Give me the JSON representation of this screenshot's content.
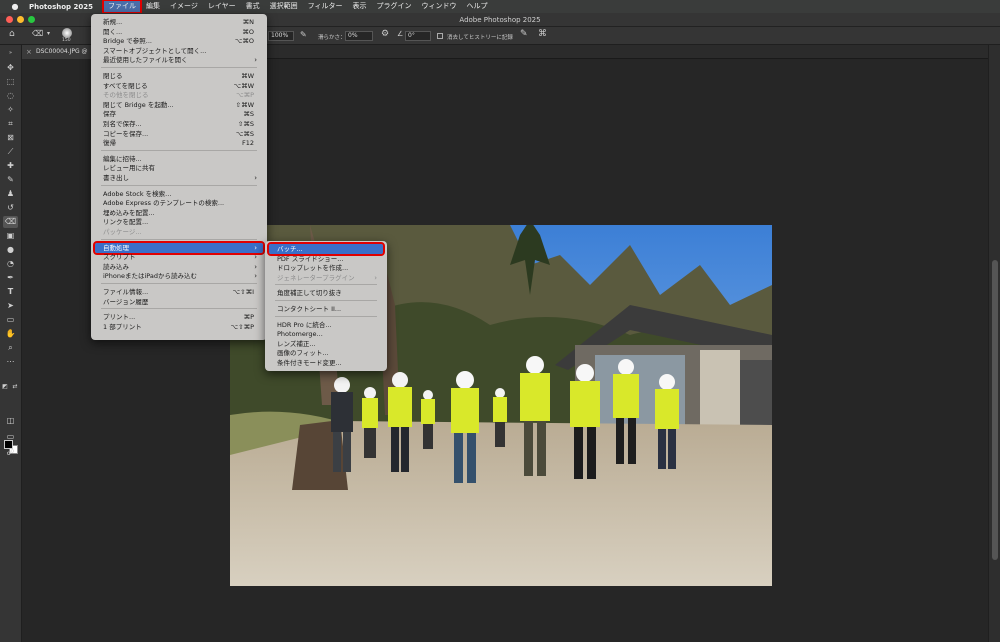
{
  "menubar": {
    "app_name": "Photoshop 2025",
    "items": [
      "ファイル",
      "編集",
      "イメージ",
      "レイヤー",
      "書式",
      "選択範囲",
      "フィルター",
      "表示",
      "プラグイン",
      "ウィンドウ",
      "ヘルプ"
    ]
  },
  "window": {
    "title": "Adobe Photoshop 2025"
  },
  "options_bar": {
    "brush_size": "150",
    "opacity_value": "100%",
    "smoothing_label": "滑らかさ：",
    "smoothing_value": "0%",
    "angle_value": "0°",
    "history_label": "消去してヒストリーに記録"
  },
  "document_tab": {
    "name": "DSC00004.JPG @"
  },
  "file_menu": {
    "groups": [
      [
        {
          "label": "新規...",
          "shortcut": "⌘N"
        },
        {
          "label": "開く...",
          "shortcut": "⌘O"
        },
        {
          "label": "Bridge で参照...",
          "shortcut": "⌥⌘O"
        },
        {
          "label": "スマートオブジェクトとして開く..."
        },
        {
          "label": "最近使用したファイルを開く",
          "submenu": true
        }
      ],
      [
        {
          "label": "閉じる",
          "shortcut": "⌘W"
        },
        {
          "label": "すべてを閉じる",
          "shortcut": "⌥⌘W"
        },
        {
          "label": "その他を閉じる",
          "shortcut": "⌥⌘P",
          "disabled": true
        },
        {
          "label": "閉じて Bridge を起動...",
          "shortcut": "⇧⌘W"
        },
        {
          "label": "保存",
          "shortcut": "⌘S"
        },
        {
          "label": "別名で保存...",
          "shortcut": "⇧⌘S"
        },
        {
          "label": "コピーを保存...",
          "shortcut": "⌥⌘S"
        },
        {
          "label": "復帰",
          "shortcut": "F12"
        }
      ],
      [
        {
          "label": "編集に招待..."
        },
        {
          "label": "レビュー用に共有"
        },
        {
          "label": "書き出し",
          "submenu": true
        }
      ],
      [
        {
          "label": "Adobe Stock を検索..."
        },
        {
          "label": "Adobe Express のテンプレートの検索..."
        },
        {
          "label": "埋め込みを配置..."
        },
        {
          "label": "リンクを配置..."
        },
        {
          "label": "パッケージ...",
          "disabled": true
        }
      ],
      [
        {
          "label": "自動処理",
          "submenu": true,
          "highlighted": true
        },
        {
          "label": "スクリプト",
          "submenu": true
        },
        {
          "label": "読み込み",
          "submenu": true
        },
        {
          "label": "iPhoneまたはiPadから読み込む",
          "submenu": true
        }
      ],
      [
        {
          "label": "ファイル情報...",
          "shortcut": "⌥⇧⌘I"
        },
        {
          "label": "バージョン履歴"
        }
      ],
      [
        {
          "label": "プリント...",
          "shortcut": "⌘P"
        },
        {
          "label": "1 部プリント",
          "shortcut": "⌥⇧⌘P"
        }
      ]
    ]
  },
  "automate_submenu": {
    "groups": [
      [
        {
          "label": "バッチ...",
          "highlighted": true
        },
        {
          "label": "PDF スライドショー..."
        },
        {
          "label": "ドロップレットを作成..."
        },
        {
          "label": "ジェネレータープラグイン",
          "submenu": true,
          "disabled": true
        }
      ],
      [
        {
          "label": "角度補正して切り抜き"
        }
      ],
      [
        {
          "label": "コンタクトシート II..."
        }
      ],
      [
        {
          "label": "HDR Pro に統合..."
        },
        {
          "label": "Photomerge..."
        },
        {
          "label": "レンズ補正..."
        },
        {
          "label": "画像のフィット..."
        },
        {
          "label": "条件付きモード変更..."
        }
      ]
    ]
  },
  "colors": {
    "menu_bg": "#c9c8c6",
    "highlight": "#3a6fc8",
    "annotation": "#e00000",
    "app_bg": "#262626"
  }
}
